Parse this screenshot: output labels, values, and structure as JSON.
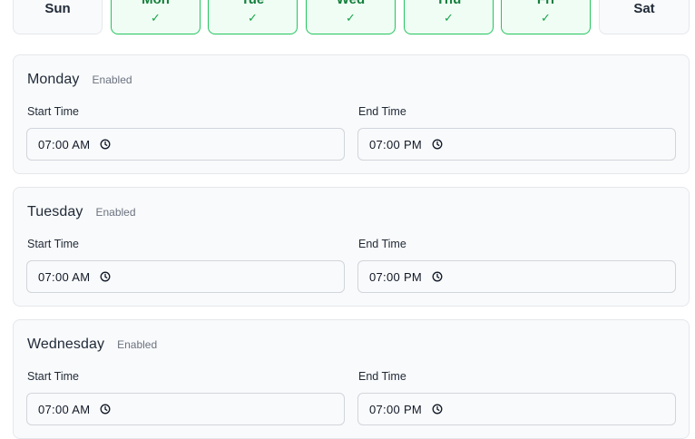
{
  "days": [
    {
      "label": "Sun",
      "selected": false,
      "check": ""
    },
    {
      "label": "Mon",
      "selected": true,
      "check": "✓"
    },
    {
      "label": "Tue",
      "selected": true,
      "check": "✓"
    },
    {
      "label": "Wed",
      "selected": true,
      "check": "✓"
    },
    {
      "label": "Thu",
      "selected": true,
      "check": "✓"
    },
    {
      "label": "Fri",
      "selected": true,
      "check": "✓"
    },
    {
      "label": "Sat",
      "selected": false,
      "check": ""
    }
  ],
  "schedules": [
    {
      "title": "Monday",
      "status": "Enabled",
      "start_label": "Start Time",
      "start_value": "07:00 AM",
      "end_label": "End Time",
      "end_value": "07:00 PM"
    },
    {
      "title": "Tuesday",
      "status": "Enabled",
      "start_label": "Start Time",
      "start_value": "07:00 AM",
      "end_label": "End Time",
      "end_value": "07:00 PM"
    },
    {
      "title": "Wednesday",
      "status": "Enabled",
      "start_label": "Start Time",
      "start_value": "07:00 AM",
      "end_label": "End Time",
      "end_value": "07:00 PM"
    }
  ],
  "icons": {
    "check": "check-icon",
    "time": "clock-icon"
  },
  "colors": {
    "selected_border": "#22c55e",
    "selected_bg": "#f0fdf4",
    "selected_text": "#15803d"
  }
}
